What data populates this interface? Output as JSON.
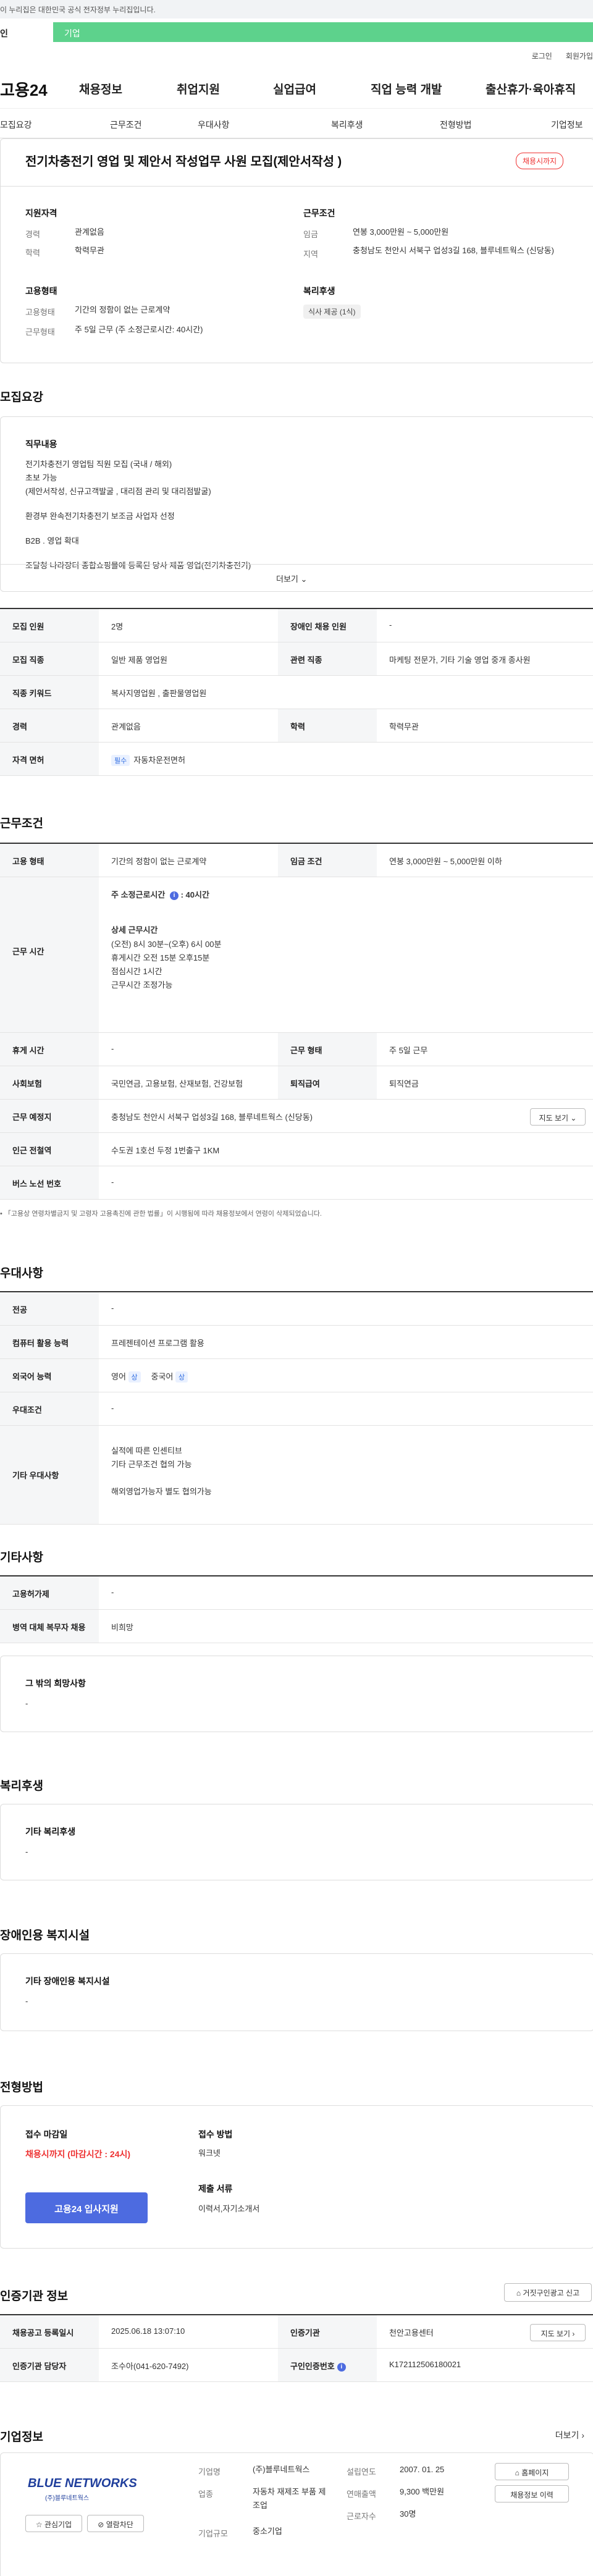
{
  "gov": {
    "text": "이 누리집은 대한민국 공식 전자정부 누리집입니다."
  },
  "topTabs": {
    "a": "인",
    "b": "기업"
  },
  "util": {
    "login": "로그인",
    "join": "회원가입"
  },
  "gnb": {
    "logo": "고용24",
    "items": [
      "채용정보",
      "취업지원",
      "실업급여",
      "직업 능력 개발",
      "출산휴가·육아휴직"
    ]
  },
  "subnav": [
    "모집요강",
    "근무조건",
    "우대사항",
    "복리후생",
    "전형방법",
    "기업정보"
  ],
  "job": {
    "title": "전기차충전기 영업 및 제안서 작성업무 사원 모집(제안서작성 )",
    "status": "채용시까지",
    "qual_head": "지원자격",
    "qual": [
      {
        "k": "경력",
        "v": "관계없음"
      },
      {
        "k": "학력",
        "v": "학력무관"
      }
    ],
    "cond_head": "근무조건",
    "cond": [
      {
        "k": "임금",
        "v": "연봉 3,000만원 ~ 5,000만원"
      },
      {
        "k": "지역",
        "v": "충청남도 천안시 서북구 업성3길 168, 블루네트웍스 (신당동)"
      }
    ],
    "emp_head": "고용형태",
    "emp": [
      {
        "k": "고용형태",
        "v": "기간의 정함이 없는 근로계약"
      },
      {
        "k": "근무형태",
        "v": "주 5일 근무 (주 소정근로시간: 40시간)"
      }
    ],
    "welfare_head": "복리후생",
    "welfare_chip": "식사 제공 (1식)"
  },
  "recruit": {
    "title": "모집요강",
    "content_head": "직무내용",
    "content": [
      "전기차충전기 영업팀 직원 모집 (국내 / 해외)",
      "초보 가능",
      "(제안서작성, 신규고객발굴 , 대리점 관리 및 대리점발굴)",
      "",
      "환경부 완속전기차충전기 보조금 사업자 선정",
      "",
      "B2B . 영업 확대",
      "",
      "조달청 나라장터 종합쇼핑몰에 등록된 당사 제품 영업(전기차충전기)"
    ],
    "more": "더보기"
  },
  "recruitTable": {
    "count_k": "모집 인원",
    "count_v": "2명",
    "disab_k": "장애인 채용 인원",
    "disab_v": "-",
    "job_k": "모집 직종",
    "job_v": "일반 제품 영업원",
    "rel_k": "관련 직종",
    "rel_v": "마케팅 전문가, 기타 기술 영업 중개 종사원",
    "kw_k": "직종 키워드",
    "kw_v": "복사지영업원 , 출판물영업원",
    "career_k": "경력",
    "career_v": "관계없음",
    "edu_k": "학력",
    "edu_v": "학력무관",
    "lic_k": "자격 면허",
    "lic_badge": "필수",
    "lic_v": "자동차운전면허"
  },
  "work": {
    "title": "근무조건",
    "type_k": "고용 형태",
    "type_v": "기간의 정함이 없는 근로계약",
    "wage_k": "임금 조건",
    "wage_v": "연봉 3,000만원 ~ 5,000만원 이하",
    "time_k": "근무 시간",
    "time_head": "주 소정근로시간",
    "time_hours": "40시간",
    "time_detail_head": "상세 근무시간",
    "time_detail": [
      "(오전) 8시 30분~(오후) 6시 00분",
      "휴게시간  오전 15분 오후15분",
      "점심시간  1시간",
      "근무시간 조정가능"
    ],
    "rest_k": "휴게 시간",
    "rest_v": "-",
    "form_k": "근무 형태",
    "form_v": "주 5일 근무",
    "ins_k": "사회보험",
    "ins_v": "국민연금, 고용보험, 산재보험, 건강보험",
    "ret_k": "퇴직급여",
    "ret_v": "퇴직연금",
    "place_k": "근무 예정지",
    "place_v": "충청남도 천안시 서북구 업성3길 168, 블루네트웍스 (신당동)",
    "map_btn": "지도 보기",
    "station_k": "인근 전철역",
    "station_v": "수도권 1호선 두정 1번출구 1KM",
    "bus_k": "버스 노선 번호",
    "bus_v": "-",
    "note": "「고용상 연령차별금지 및 고령자 고용촉진에 관한 법률」이 시행됨에 따라 채용정보에서 연령이 삭제되었습니다."
  },
  "pref": {
    "title": "우대사항",
    "major_k": "전공",
    "major_v": "-",
    "pc_k": "컴퓨터 활용 능력",
    "pc_v": "프레젠테이션 프로그램 활용",
    "lang_k": "외국어 능력",
    "lang": [
      {
        "name": "영어",
        "lv": "상"
      },
      {
        "name": "중국어",
        "lv": "상"
      }
    ],
    "cond_k": "우대조건",
    "cond_v": "-",
    "etc_k": "기타 우대사항",
    "etc_v": [
      "실적에 따른 인센티브",
      "기타 근무조건 협의 가능",
      "",
      "해외영업가능자 별도 협의가능"
    ]
  },
  "other": {
    "title": "기타사항",
    "emp_k": "고용허가제",
    "emp_v": "-",
    "mil_k": "병역 대체 복무자 채용",
    "mil_v": "비희망",
    "hope_head": "그 밖의 희망사항",
    "hope_v": "-"
  },
  "welfare": {
    "title": "복리후생",
    "head": "기타 복리후생",
    "v": "-"
  },
  "disab": {
    "title": "장애인용 복지시설",
    "head": "기타 장애인용 복지시설",
    "v": "-"
  },
  "process": {
    "title": "전형방법",
    "deadline_head": "접수 마감일",
    "deadline_v": "채용시까지 (마감시간 : 24시)",
    "apply_btn": "고용24 입사지원",
    "method_head": "접수 방법",
    "method_v": "워크넷",
    "docs_head": "제출 서류",
    "docs_v": "이력서,자기소개서"
  },
  "cert": {
    "title": "인증기관 정보",
    "report_btn": "거짓구인광고 신고",
    "reg_k": "채용공고 등록일시",
    "reg_v": "2025.06.18 13:07:10",
    "org_k": "인증기관",
    "org_v": "천안고용센터",
    "map_btn": "지도 보기",
    "mgr_k": "인증기관 담당자",
    "mgr_v": "조수아(041-620-7492)",
    "no_k": "구인인증번호",
    "no_v": "K172112506180021"
  },
  "company": {
    "title": "기업정보",
    "more": "더보기",
    "logo_main": "BLUE NETWORKS",
    "logo_sub": "(주)블루네트웍스",
    "fav_btn": "관심기업",
    "block_btn": "열람차단",
    "name_k": "기업명",
    "name_v": "(주)블루네트웍스",
    "ind_k": "업종",
    "ind_v": "자동차 재제조 부품 제조업",
    "size_k": "기업규모",
    "size_v": "중소기업",
    "found_k": "설립연도",
    "found_v": "2007. 01. 25",
    "sales_k": "연매출액",
    "sales_v": "9,300 백만원",
    "staff_k": "근로자수",
    "staff_v": "30명",
    "home_btn": "홈페이지",
    "list_btn": "채용정보 이력"
  },
  "colors": {
    "accent": "#4d6be0",
    "green": "#5dd28c",
    "red": "#e33333"
  }
}
